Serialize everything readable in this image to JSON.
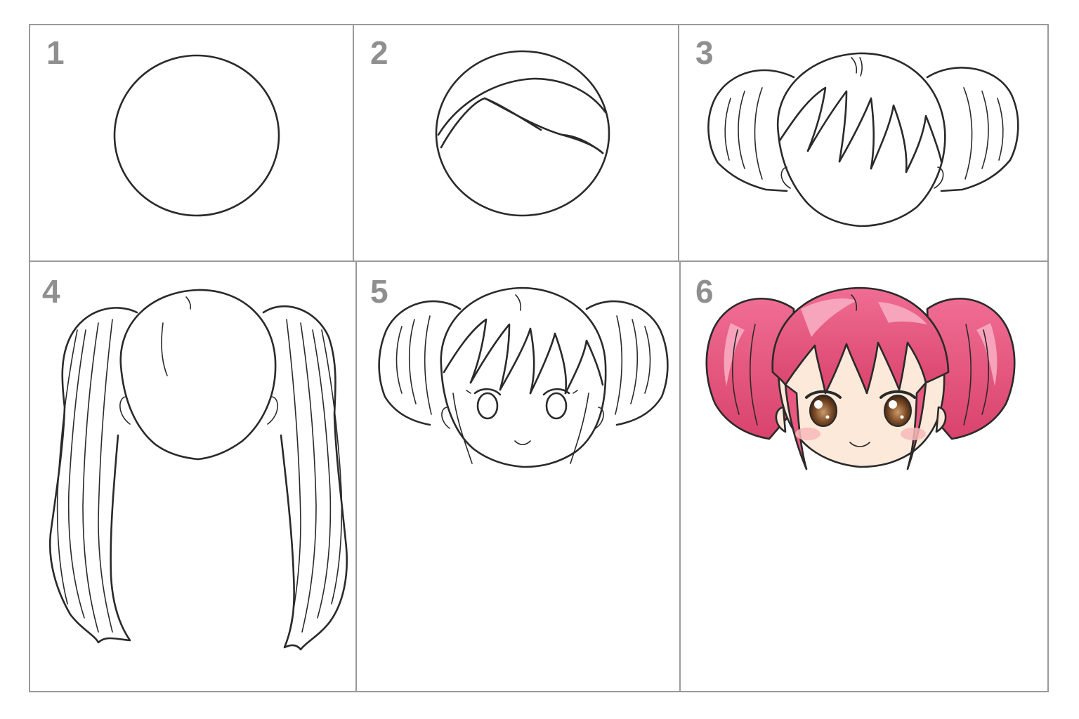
{
  "steps": [
    {
      "number": "1"
    },
    {
      "number": "2"
    },
    {
      "number": "3"
    },
    {
      "number": "4"
    },
    {
      "number": "5"
    },
    {
      "number": "6"
    }
  ],
  "colors": {
    "grid_line": "#9a9a9a",
    "number_text": "#8f8f8f",
    "ink": "#2a2a2a",
    "hair_pink": "#e8587f",
    "hair_pink_light": "#f493ad",
    "hair_pink_dark": "#c93a62",
    "skin": "#fde9d9",
    "blush": "#f7b9b9",
    "eye_brown": "#7a4a26"
  },
  "icons": [
    "circle-sketch",
    "hair-guideline",
    "pigtail-head",
    "long-pigtails-head",
    "lineart-face",
    "colored-face"
  ]
}
